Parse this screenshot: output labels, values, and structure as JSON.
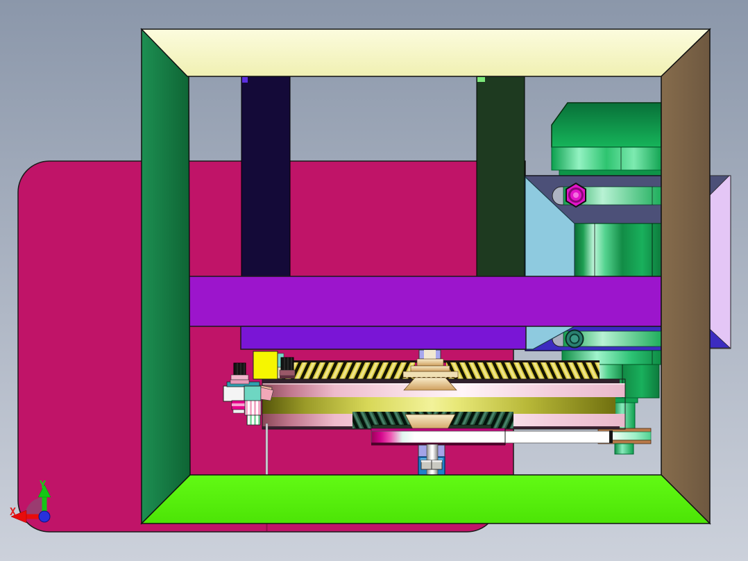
{
  "viewport": {
    "description": "CAD shaded 3D view of a gear-and-motor test rig assembly",
    "background_top": "#8b97aa",
    "background_bottom": "#ccd1db"
  },
  "axis_triad": {
    "x_label": "X",
    "y_label": "Y",
    "x_color": "#e02020",
    "y_color": "#16d016",
    "origin_color": "#2830dc"
  },
  "parts": {
    "housing_body": {
      "name": "housing body",
      "color": "#c01468"
    },
    "frame_top_panel": {
      "name": "top frame panel",
      "color": "#fafad2"
    },
    "frame_left_column": {
      "name": "left frame column",
      "color": "#177f47"
    },
    "frame_right_column": {
      "name": "right frame column",
      "color": "#7d6548"
    },
    "frame_bottom_panel": {
      "name": "bottom frame panel",
      "color": "#58f50c"
    },
    "inner_column_navy": {
      "name": "inner column (navy)",
      "color": "#140a38"
    },
    "inner_column_green": {
      "name": "inner column (dark green)",
      "color": "#1e3a20"
    },
    "beam_upper": {
      "name": "upper cross beam",
      "color": "#9c15cc"
    },
    "beam_lower": {
      "name": "lower cross beam",
      "color": "#7a15d6"
    },
    "mount_plate_top": {
      "name": "motor mount plate upper",
      "color": "#4c5078"
    },
    "mount_plate_bottom": {
      "name": "motor mount plate lower",
      "color": "#3c2cc0"
    },
    "mount_side_panel": {
      "name": "mount side panel",
      "color": "#8ecadf"
    },
    "mount_back_panel": {
      "name": "mount back panel",
      "color": "#e4c6f6"
    },
    "motor_body": {
      "name": "motor body",
      "color": "#12a452"
    },
    "hex_bolt_magenta": {
      "name": "hex bolt",
      "color": "#e214c8"
    },
    "bolt_teal": {
      "name": "round bolt",
      "color": "#2a8070"
    },
    "gear_disc_pink": {
      "name": "gear wheel rim",
      "color": "#f3cddc"
    },
    "gear_disc_olive": {
      "name": "gear wheel band",
      "color": "#d8d858"
    },
    "belt": {
      "name": "flat belt",
      "color": "#ffffff"
    },
    "bearing_block": {
      "name": "bearing block",
      "color": "#a3a3e8"
    },
    "bearing_housing": {
      "name": "bearing housing",
      "color": "#2080c8"
    },
    "clamp_block_yellow": {
      "name": "clamp block",
      "color": "#f6f600"
    }
  }
}
